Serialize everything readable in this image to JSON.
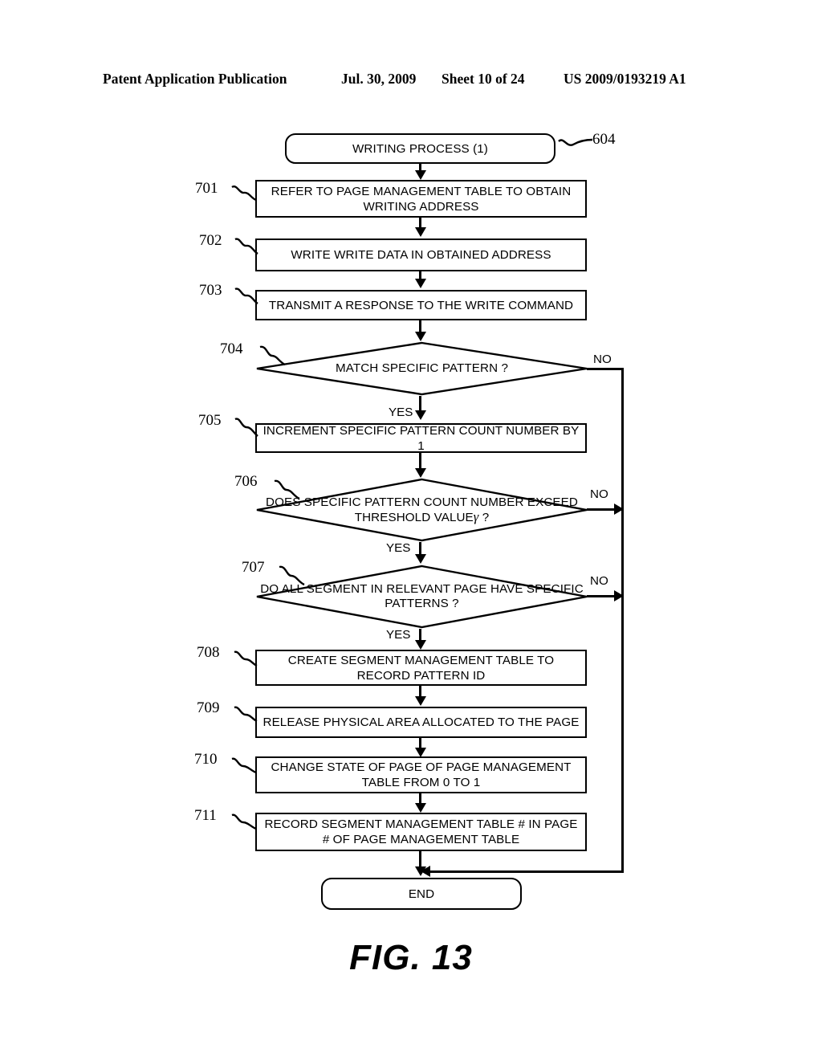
{
  "header": {
    "publication": "Patent Application Publication",
    "date": "Jul. 30, 2009",
    "sheet": "Sheet 10 of 24",
    "patent_number": "US 2009/0193219 A1"
  },
  "figure": {
    "caption": "FIG. 13",
    "title_ref": "604"
  },
  "flowchart": {
    "start": {
      "ref": "604",
      "label": "WRITING PROCESS (1)"
    },
    "end": {
      "label": "END"
    },
    "steps": [
      {
        "ref": "701",
        "label": "REFER TO PAGE MANAGEMENT TABLE TO OBTAIN WRITING ADDRESS",
        "type": "process"
      },
      {
        "ref": "702",
        "label": "WRITE WRITE DATA IN OBTAINED ADDRESS",
        "type": "process"
      },
      {
        "ref": "703",
        "label": "TRANSMIT A RESPONSE TO THE WRITE COMMAND",
        "type": "process"
      },
      {
        "ref": "704",
        "label": "MATCH SPECIFIC PATTERN ?",
        "type": "decision"
      },
      {
        "ref": "705",
        "label": "INCREMENT SPECIFIC PATTERN COUNT NUMBER BY 1",
        "type": "process"
      },
      {
        "ref": "706",
        "label": "DOES SPECIFIC PATTERN COUNT NUMBER EXCEED THRESHOLD VALUE",
        "label_suffix": "?",
        "symbol": "γ",
        "type": "decision"
      },
      {
        "ref": "707",
        "label": "DO ALL SEGMENT IN RELEVANT PAGE HAVE SPECIFIC PATTERNS ?",
        "type": "decision"
      },
      {
        "ref": "708",
        "label": "CREATE SEGMENT MANAGEMENT TABLE TO RECORD PATTERN ID",
        "type": "process"
      },
      {
        "ref": "709",
        "label": "RELEASE PHYSICAL AREA ALLOCATED TO THE PAGE",
        "type": "process"
      },
      {
        "ref": "710",
        "label": "CHANGE STATE OF PAGE OF PAGE MANAGEMENT TABLE FROM 0 TO 1",
        "type": "process"
      },
      {
        "ref": "711",
        "label": "RECORD SEGMENT MANAGEMENT TABLE # IN PAGE # OF PAGE MANAGEMENT TABLE",
        "type": "process"
      }
    ],
    "branch_labels": {
      "yes": "YES",
      "no": "NO"
    },
    "decision_branches": [
      {
        "from": "704",
        "yes": "YES",
        "no": "NO"
      },
      {
        "from": "706",
        "yes": "YES",
        "no": "NO"
      },
      {
        "from": "707",
        "yes": "YES",
        "no": "NO"
      }
    ],
    "colors": {
      "line": "#000000",
      "background": "#ffffff",
      "text": "#000000"
    }
  }
}
